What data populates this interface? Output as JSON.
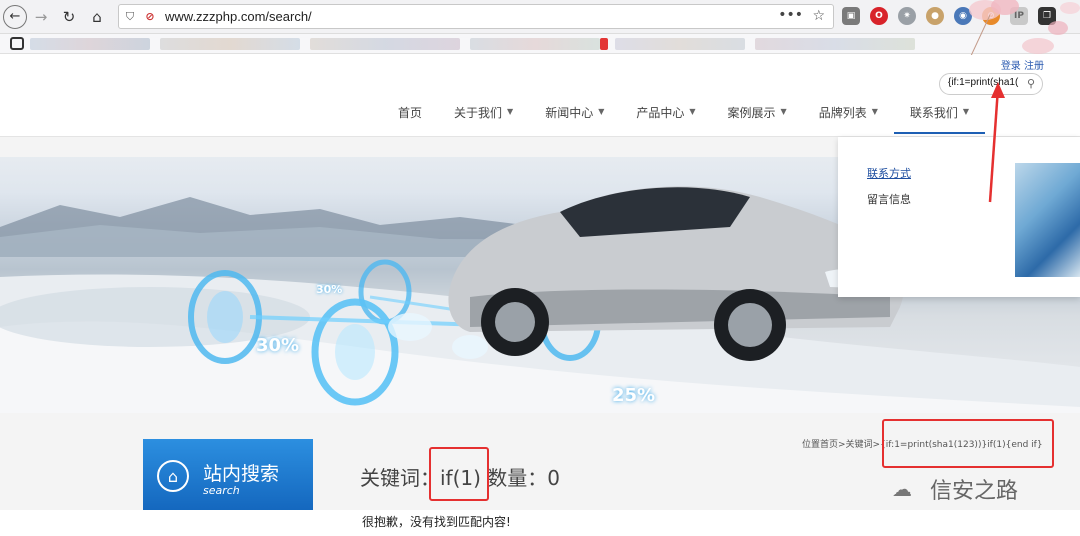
{
  "browser": {
    "url": "www.zzzphp.com/search/",
    "menu_dots": "•••",
    "ext_ip": "IP"
  },
  "header": {
    "login": "登录",
    "register": "注册",
    "search_value": "{if:1=print(sha1("
  },
  "nav": [
    {
      "label": "首页",
      "caret": false
    },
    {
      "label": "关于我们",
      "caret": true
    },
    {
      "label": "新闻中心",
      "caret": true
    },
    {
      "label": "产品中心",
      "caret": true
    },
    {
      "label": "案例展示",
      "caret": true
    },
    {
      "label": "品牌列表",
      "caret": true
    },
    {
      "label": "联系我们",
      "caret": true
    }
  ],
  "dropdown": {
    "item1": "联系方式",
    "item2": "留言信息"
  },
  "hero": {
    "labels": [
      "30%",
      "30%",
      "25%"
    ]
  },
  "sidebar": {
    "title": "站内搜索",
    "subtitle": "search"
  },
  "main": {
    "breadcrumb": "位置首页>关键词>{if:1=print(sha1(123))}if(1){end if}",
    "keyword_prefix": "关键词：",
    "keyword_value": "if(1)",
    "count_label": " 数量：0",
    "no_result": "很抱歉，没有找到匹配内容!"
  },
  "watermark": {
    "text": "信安之路"
  },
  "colors": {
    "accent": "#1e5fb4",
    "annotation": "#e53030"
  }
}
